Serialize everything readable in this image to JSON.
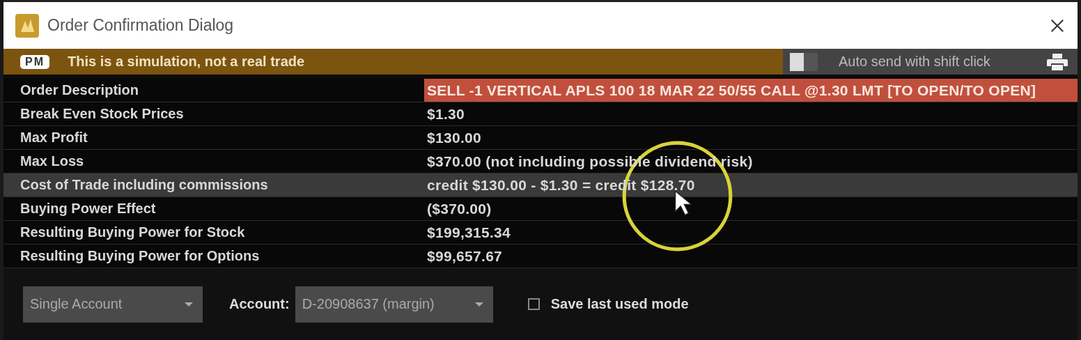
{
  "window": {
    "title": "Order Confirmation Dialog"
  },
  "banner": {
    "badge": "PM",
    "message": "This is a simulation, not a real trade",
    "auto_send": {
      "label": "Auto send with shift click",
      "on": false
    }
  },
  "rows": [
    {
      "label": "Order Description",
      "value": "SELL -1 VERTICAL APLS 100 18 MAR 22 50/55 CALL @1.30 LMT [TO OPEN/TO OPEN]",
      "kind": "alert",
      "highlighted": false
    },
    {
      "label": "Break Even Stock Prices",
      "value": "$1.30",
      "kind": "plain",
      "highlighted": false
    },
    {
      "label": "Max Profit",
      "value": "$130.00",
      "kind": "plain",
      "highlighted": false
    },
    {
      "label": "Max Loss",
      "value": "$370.00 (not including possible dividend risk)",
      "kind": "plain",
      "highlighted": false
    },
    {
      "label": "Cost of Trade including commissions",
      "value": "credit $130.00 - $1.30 = credit $128.70",
      "kind": "plain",
      "highlighted": true
    },
    {
      "label": "Buying Power Effect",
      "value": "($370.00)",
      "kind": "plain",
      "highlighted": false
    },
    {
      "label": "Resulting Buying Power for Stock",
      "value": "$199,315.34",
      "kind": "plain",
      "highlighted": false
    },
    {
      "label": "Resulting Buying Power for Options",
      "value": "$99,657.67",
      "kind": "plain",
      "highlighted": false
    }
  ],
  "footer": {
    "mode": {
      "value": "Single Account"
    },
    "account": {
      "label": "Account:",
      "value": "D-20908637 (margin)"
    },
    "save_mode": {
      "label": "Save last used mode",
      "checked": false
    }
  }
}
